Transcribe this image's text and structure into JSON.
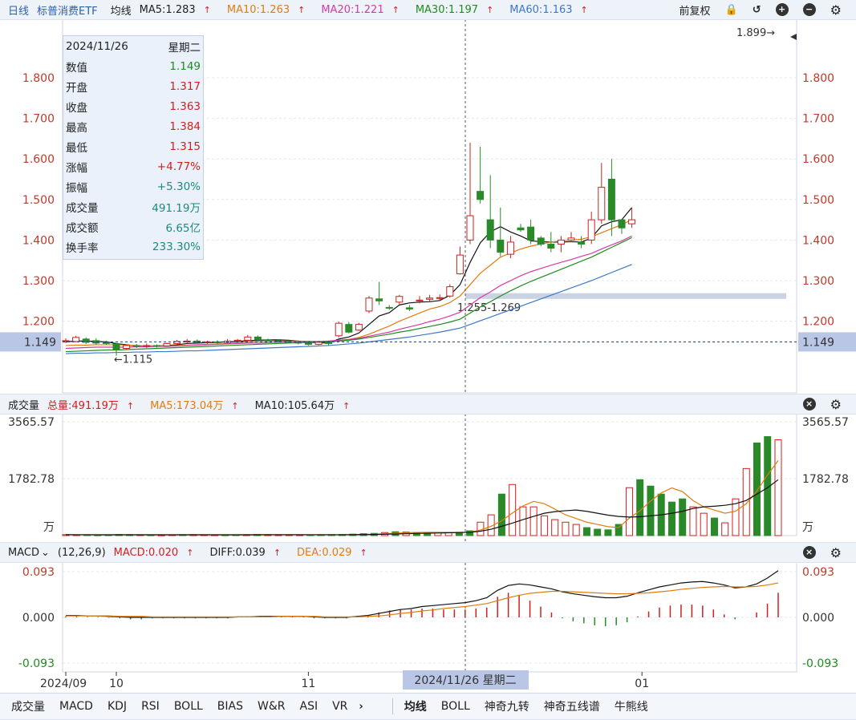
{
  "header": {
    "period": "日线",
    "name": "标普消费ETF",
    "ma_label": "均线",
    "ma5": "MA5:1.283",
    "ma10": "MA10:1.263",
    "ma20": "MA20:1.221",
    "ma30": "MA30:1.197",
    "ma60": "MA60:1.163",
    "adjust": "前复权",
    "icons": [
      "lock-icon",
      "undo-icon",
      "zoom-in-icon",
      "zoom-out-icon",
      "gear-icon"
    ]
  },
  "infobox": {
    "date": "2024/11/26",
    "weekday": "星期二",
    "rows": [
      {
        "label": "数值",
        "value": "1.149",
        "color": "#1e8c1e"
      },
      {
        "label": "开盘",
        "value": "1.317",
        "color": "#d01f1f"
      },
      {
        "label": "收盘",
        "value": "1.363",
        "color": "#d01f1f"
      },
      {
        "label": "最高",
        "value": "1.384",
        "color": "#d01f1f"
      },
      {
        "label": "最低",
        "value": "1.315",
        "color": "#d01f1f"
      },
      {
        "label": "涨幅",
        "value": "+4.77%",
        "color": "#d01f1f"
      },
      {
        "label": "振幅",
        "value": "+5.30%",
        "color": "#1e8a7a"
      },
      {
        "label": "成交量",
        "value": "491.19万",
        "color": "#1e8a7a"
      },
      {
        "label": "成交额",
        "value": "6.65亿",
        "color": "#1e8a7a"
      },
      {
        "label": "换手率",
        "value": "233.30%",
        "color": "#1e8a7a"
      }
    ]
  },
  "volume_bar": {
    "title": "成交量",
    "total": "总量:491.19万",
    "ma5": "MA5:173.04万",
    "ma10": "MA10:105.64万"
  },
  "macd_bar": {
    "title": "MACD",
    "params": "(12,26,9)",
    "macd": "MACD:0.020",
    "diff": "DIFF:0.039",
    "dea": "DEA:0.029"
  },
  "bottom_tabs_left": [
    "成交量",
    "MACD",
    "KDJ",
    "RSI",
    "BOLL",
    "BIAS",
    "W&R",
    "ASI",
    "VR"
  ],
  "bottom_tabs_right": [
    "均线",
    "BOLL",
    "神奇九转",
    "神奇五线谱",
    "牛熊线"
  ],
  "colors": {
    "up": "#d01f1f",
    "down": "#2a8a2a",
    "ma5": "#111111",
    "ma10": "#e07c10",
    "ma20": "#d63aa6",
    "ma30": "#1e8c1e",
    "ma60": "#3f77c8"
  },
  "chart_data": {
    "type": "candlestick",
    "price_axis": {
      "ticks": [
        1.8,
        1.7,
        1.6,
        1.5,
        1.4,
        1.3,
        1.2
      ],
      "tick_labels": [
        "1.800",
        "1.700",
        "1.600",
        "1.500",
        "1.400",
        "1.300",
        "1.200"
      ],
      "current": "1.149"
    },
    "annotations": {
      "high": "1.899→",
      "low": "←1.115",
      "zone": "1.255-1.269",
      "cursor_label": "2024/11/26 星期二"
    },
    "x_labels": [
      {
        "i": 0,
        "text": "2024/09"
      },
      {
        "i": 5,
        "text": "10"
      },
      {
        "i": 24,
        "text": "11"
      },
      {
        "i": 57,
        "text": "01"
      }
    ],
    "candles": [
      [
        1.151,
        1.152,
        1.158,
        1.146
      ],
      [
        1.15,
        1.16,
        1.164,
        1.148
      ],
      [
        1.156,
        1.148,
        1.16,
        1.144
      ],
      [
        1.152,
        1.146,
        1.158,
        1.142
      ],
      [
        1.147,
        1.145,
        1.152,
        1.141
      ],
      [
        1.144,
        1.131,
        1.146,
        1.115
      ],
      [
        1.133,
        1.14,
        1.143,
        1.129
      ],
      [
        1.14,
        1.138,
        1.144,
        1.134
      ],
      [
        1.138,
        1.14,
        1.145,
        1.134
      ],
      [
        1.14,
        1.139,
        1.143,
        1.135
      ],
      [
        1.139,
        1.145,
        1.147,
        1.137
      ],
      [
        1.145,
        1.15,
        1.154,
        1.142
      ],
      [
        1.149,
        1.151,
        1.156,
        1.145
      ],
      [
        1.151,
        1.148,
        1.155,
        1.146
      ],
      [
        1.148,
        1.149,
        1.152,
        1.144
      ],
      [
        1.149,
        1.147,
        1.153,
        1.144
      ],
      [
        1.147,
        1.151,
        1.156,
        1.145
      ],
      [
        1.151,
        1.153,
        1.156,
        1.148
      ],
      [
        1.153,
        1.161,
        1.166,
        1.15
      ],
      [
        1.161,
        1.154,
        1.165,
        1.15
      ],
      [
        1.154,
        1.152,
        1.157,
        1.149
      ],
      [
        1.152,
        1.15,
        1.155,
        1.147
      ],
      [
        1.15,
        1.148,
        1.153,
        1.145
      ],
      [
        1.148,
        1.146,
        1.15,
        1.143
      ],
      [
        1.146,
        1.143,
        1.149,
        1.14
      ],
      [
        1.143,
        1.148,
        1.151,
        1.141
      ],
      [
        1.15,
        1.145,
        1.152,
        1.14
      ],
      [
        1.164,
        1.195,
        1.199,
        1.16
      ],
      [
        1.192,
        1.173,
        1.198,
        1.17
      ],
      [
        1.178,
        1.192,
        1.196,
        1.176
      ],
      [
        1.225,
        1.257,
        1.262,
        1.22
      ],
      [
        1.255,
        1.25,
        1.297,
        1.24
      ],
      [
        1.234,
        1.232,
        1.24,
        1.228
      ],
      [
        1.247,
        1.261,
        1.265,
        1.242
      ],
      [
        1.233,
        1.23,
        1.24,
        1.225
      ],
      [
        1.25,
        1.252,
        1.262,
        1.244
      ],
      [
        1.254,
        1.257,
        1.265,
        1.248
      ],
      [
        1.257,
        1.258,
        1.266,
        1.252
      ],
      [
        1.262,
        1.285,
        1.291,
        1.258
      ],
      [
        1.317,
        1.363,
        1.384,
        1.315
      ],
      [
        1.4,
        1.46,
        1.64,
        1.39
      ],
      [
        1.52,
        1.5,
        1.63,
        1.49
      ],
      [
        1.45,
        1.4,
        1.56,
        1.38
      ],
      [
        1.4,
        1.37,
        1.48,
        1.36
      ],
      [
        1.365,
        1.395,
        1.41,
        1.355
      ],
      [
        1.43,
        1.425,
        1.44,
        1.42
      ],
      [
        1.432,
        1.4,
        1.45,
        1.39
      ],
      [
        1.405,
        1.39,
        1.41,
        1.385
      ],
      [
        1.39,
        1.38,
        1.42,
        1.37
      ],
      [
        1.39,
        1.4,
        1.41,
        1.37
      ],
      [
        1.4,
        1.405,
        1.42,
        1.395
      ],
      [
        1.395,
        1.39,
        1.41,
        1.38
      ],
      [
        1.4,
        1.45,
        1.47,
        1.39
      ],
      [
        1.45,
        1.53,
        1.59,
        1.44
      ],
      [
        1.55,
        1.45,
        1.6,
        1.41
      ],
      [
        1.45,
        1.43,
        1.44,
        1.415
      ],
      [
        1.44,
        1.45,
        1.48,
        1.43
      ]
    ],
    "ma_series": {
      "MA5": [
        1.149,
        1.151,
        1.151,
        1.15,
        1.149,
        1.145,
        1.142,
        1.139,
        1.139,
        1.139,
        1.14,
        1.142,
        1.145,
        1.146,
        1.147,
        1.148,
        1.149,
        1.15,
        1.152,
        1.153,
        1.154,
        1.154,
        1.153,
        1.151,
        1.148,
        1.147,
        1.146,
        1.156,
        1.161,
        1.171,
        1.192,
        1.213,
        1.221,
        1.24,
        1.245,
        1.247,
        1.248,
        1.251,
        1.264,
        1.29,
        1.345,
        1.393,
        1.42,
        1.433,
        1.42,
        1.41,
        1.398,
        1.396,
        1.395,
        1.395,
        1.396,
        1.395,
        1.405,
        1.435,
        1.445,
        1.45,
        1.48
      ],
      "MA10": [
        1.14,
        1.141,
        1.141,
        1.142,
        1.142,
        1.142,
        1.141,
        1.14,
        1.139,
        1.139,
        1.139,
        1.14,
        1.141,
        1.142,
        1.143,
        1.144,
        1.145,
        1.147,
        1.148,
        1.15,
        1.151,
        1.151,
        1.151,
        1.151,
        1.15,
        1.149,
        1.149,
        1.152,
        1.155,
        1.16,
        1.168,
        1.178,
        1.188,
        1.2,
        1.21,
        1.22,
        1.23,
        1.236,
        1.246,
        1.262,
        1.29,
        1.318,
        1.338,
        1.358,
        1.368,
        1.378,
        1.385,
        1.39,
        1.395,
        1.398,
        1.4,
        1.402,
        1.408,
        1.418,
        1.428,
        1.438,
        1.45
      ],
      "MA20": [
        1.133,
        1.134,
        1.135,
        1.136,
        1.136,
        1.136,
        1.136,
        1.137,
        1.137,
        1.138,
        1.138,
        1.139,
        1.14,
        1.141,
        1.142,
        1.143,
        1.144,
        1.145,
        1.146,
        1.146,
        1.147,
        1.148,
        1.149,
        1.15,
        1.15,
        1.15,
        1.151,
        1.153,
        1.155,
        1.158,
        1.163,
        1.168,
        1.173,
        1.18,
        1.186,
        1.192,
        1.199,
        1.205,
        1.213,
        1.222,
        1.24,
        1.258,
        1.272,
        1.288,
        1.3,
        1.312,
        1.322,
        1.33,
        1.338,
        1.345,
        1.352,
        1.36,
        1.367,
        1.378,
        1.388,
        1.398,
        1.41
      ],
      "MA30": [
        1.125,
        1.126,
        1.127,
        1.128,
        1.129,
        1.129,
        1.13,
        1.131,
        1.132,
        1.133,
        1.134,
        1.135,
        1.136,
        1.137,
        1.138,
        1.139,
        1.14,
        1.141,
        1.142,
        1.143,
        1.144,
        1.145,
        1.146,
        1.147,
        1.148,
        1.148,
        1.149,
        1.151,
        1.153,
        1.156,
        1.16,
        1.164,
        1.168,
        1.173,
        1.177,
        1.182,
        1.187,
        1.192,
        1.198,
        1.205,
        1.22,
        1.235,
        1.248,
        1.262,
        1.275,
        1.287,
        1.298,
        1.308,
        1.318,
        1.328,
        1.338,
        1.348,
        1.358,
        1.37,
        1.382,
        1.394,
        1.406
      ],
      "MA60": [
        1.12,
        1.121,
        1.121,
        1.122,
        1.122,
        1.123,
        1.123,
        1.124,
        1.124,
        1.125,
        1.125,
        1.126,
        1.127,
        1.127,
        1.128,
        1.129,
        1.13,
        1.131,
        1.132,
        1.133,
        1.134,
        1.135,
        1.136,
        1.137,
        1.138,
        1.139,
        1.14,
        1.142,
        1.144,
        1.146,
        1.149,
        1.152,
        1.155,
        1.158,
        1.161,
        1.165,
        1.169,
        1.173,
        1.178,
        1.183,
        1.192,
        1.201,
        1.21,
        1.219,
        1.228,
        1.237,
        1.246,
        1.255,
        1.264,
        1.273,
        1.282,
        1.291,
        1.3,
        1.31,
        1.32,
        1.33,
        1.34
      ]
    },
    "volume_axis": {
      "ticks": [
        "3565.57",
        "1782.78",
        "万"
      ]
    },
    "volumes": [
      30,
      25,
      28,
      22,
      24,
      35,
      30,
      26,
      22,
      20,
      25,
      28,
      30,
      26,
      24,
      22,
      25,
      28,
      35,
      30,
      28,
      26,
      24,
      25,
      28,
      30,
      34,
      45,
      60,
      70,
      95,
      120,
      110,
      100,
      95,
      90,
      100,
      105,
      150,
      420,
      650,
      1300,
      1600,
      900,
      900,
      620,
      500,
      420,
      350,
      250,
      200,
      180,
      350,
      1500,
      1750,
      1550,
      1300,
      1050,
      1150,
      900,
      700,
      550,
      400,
      1150,
      2100,
      2900,
      3100,
      3000
    ],
    "vol_ma5": [
      28,
      27,
      26,
      25,
      25,
      26,
      27,
      27,
      26,
      25,
      25,
      25,
      26,
      26,
      26,
      25,
      25,
      26,
      28,
      29,
      29,
      29,
      28,
      27,
      26,
      26,
      27,
      31,
      37,
      46,
      59,
      76,
      89,
      99,
      104,
      103,
      100,
      98,
      108,
      173,
      290,
      464,
      707,
      929,
      1071,
      1000,
      830,
      650,
      534,
      420,
      350,
      280,
      250,
      546,
      778,
      1080,
      1336,
      1494,
      1376,
      1096,
      900,
      800,
      700,
      763,
      1000,
      1400,
      1900,
      2350
    ],
    "vol_ma10": [
      28,
      27,
      27,
      26,
      26,
      26,
      26,
      26,
      26,
      26,
      26,
      26,
      26,
      26,
      26,
      26,
      26,
      26,
      26,
      27,
      27,
      27,
      27,
      27,
      27,
      27,
      27,
      28,
      31,
      35,
      42,
      51,
      59,
      67,
      74,
      80,
      88,
      96,
      104,
      138,
      200,
      292,
      390,
      500,
      600,
      700,
      750,
      780,
      800,
      760,
      700,
      640,
      600,
      580,
      590,
      620,
      650,
      700,
      760,
      850,
      900,
      920,
      950,
      1000,
      1100,
      1300,
      1500,
      1750
    ],
    "macd_axis": {
      "ticks": [
        "0.093",
        "0.000",
        "-0.093"
      ]
    },
    "diff": [
      0.004,
      0.004,
      0.003,
      0.003,
      0.002,
      0.001,
      0.0,
      0.0,
      0.0,
      0.0,
      0.0,
      0.0,
      0.0,
      0.0,
      0.0,
      0.0,
      0.001,
      0.001,
      0.002,
      0.002,
      0.002,
      0.002,
      0.002,
      0.001,
      0.0,
      0.0,
      0.0,
      0.002,
      0.004,
      0.008,
      0.012,
      0.016,
      0.018,
      0.022,
      0.024,
      0.026,
      0.028,
      0.03,
      0.034,
      0.04,
      0.055,
      0.065,
      0.068,
      0.066,
      0.062,
      0.058,
      0.052,
      0.048,
      0.045,
      0.042,
      0.04,
      0.04,
      0.043,
      0.05,
      0.056,
      0.062,
      0.066,
      0.07,
      0.072,
      0.073,
      0.07,
      0.066,
      0.06,
      0.062,
      0.068,
      0.08,
      0.095
    ],
    "dea": [
      0.003,
      0.003,
      0.003,
      0.003,
      0.003,
      0.002,
      0.002,
      0.002,
      0.001,
      0.001,
      0.001,
      0.001,
      0.001,
      0.001,
      0.001,
      0.001,
      0.001,
      0.001,
      0.001,
      0.001,
      0.002,
      0.002,
      0.002,
      0.002,
      0.001,
      0.001,
      0.001,
      0.001,
      0.002,
      0.003,
      0.005,
      0.008,
      0.01,
      0.013,
      0.015,
      0.018,
      0.02,
      0.022,
      0.025,
      0.028,
      0.034,
      0.04,
      0.045,
      0.049,
      0.051,
      0.053,
      0.053,
      0.052,
      0.051,
      0.05,
      0.049,
      0.048,
      0.048,
      0.049,
      0.05,
      0.052,
      0.054,
      0.057,
      0.059,
      0.061,
      0.062,
      0.063,
      0.062,
      0.062,
      0.063,
      0.066,
      0.07
    ],
    "macd_bars": [
      0.002,
      0.002,
      0.001,
      0.001,
      -0.001,
      -0.002,
      -0.004,
      -0.004,
      -0.002,
      -0.002,
      -0.002,
      -0.002,
      -0.002,
      -0.002,
      -0.002,
      -0.002,
      0.0,
      0.0,
      0.002,
      0.002,
      0.001,
      0.001,
      0.001,
      -0.002,
      -0.002,
      -0.002,
      -0.002,
      0.002,
      0.004,
      0.01,
      0.014,
      0.016,
      0.016,
      0.018,
      0.018,
      0.016,
      0.016,
      0.016,
      0.018,
      0.02,
      0.042,
      0.05,
      0.046,
      0.034,
      0.022,
      0.01,
      -0.002,
      -0.008,
      -0.012,
      -0.016,
      -0.018,
      -0.016,
      -0.01,
      0.002,
      0.012,
      0.02,
      0.024,
      0.026,
      0.026,
      0.024,
      0.016,
      0.006,
      -0.004,
      0.0,
      0.01,
      0.028,
      0.05
    ]
  }
}
